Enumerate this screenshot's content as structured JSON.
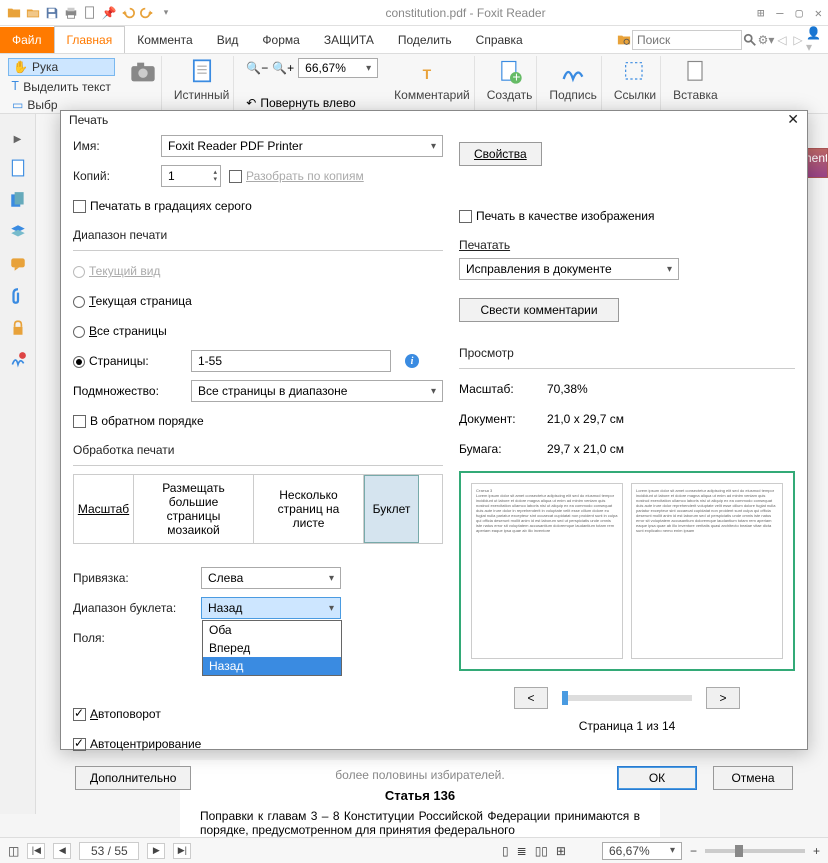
{
  "titlebar": {
    "title": "constitution.pdf - Foxit Reader"
  },
  "tabs": {
    "file": "Файл",
    "items": [
      "Главная",
      "Коммента",
      "Вид",
      "Форма",
      "ЗАЩИТА",
      "Поделить",
      "Справка"
    ],
    "active_index": 0,
    "search_placeholder": "Поиск"
  },
  "ribbon": {
    "hand": "Рука",
    "select_text": "Выделить текст",
    "selection": "Выбр",
    "true_size": "Истинный",
    "zoom_value": "66,67%",
    "rotate_left": "Повернуть влево",
    "comment": "Комментарий",
    "create": "Создать",
    "sign": "Подпись",
    "links": "Ссылки",
    "insert": "Вставка"
  },
  "dialog": {
    "title": "Печать",
    "name_label": "Имя:",
    "printer": "Foxit Reader PDF Printer",
    "properties": "Свойства",
    "copies_label": "Копий:",
    "copies": "1",
    "collate": "Разобрать по копиям",
    "grayscale": "Печатать в градациях серого",
    "as_image": "Печать в качестве изображения",
    "range_title": "Диапазон печати",
    "range": {
      "current_view": "Текущий вид",
      "current_page": "Текущая страница",
      "all_pages": "Все страницы",
      "pages": "Страницы:",
      "pages_value": "1-55",
      "selected": "pages"
    },
    "subset_label": "Подмножество:",
    "subset": "Все страницы в диапазоне",
    "reverse": "В обратном порядке",
    "handling_title": "Обработка печати",
    "handling": {
      "scale": "Масштаб",
      "tile": "Размещать большие страницы мозаикой",
      "multi": "Несколько страниц на листе",
      "booklet": "Буклет",
      "active": "booklet"
    },
    "binding_label": "Привязка:",
    "binding": "Слева",
    "booklet_range_label": "Диапазон буклета:",
    "booklet_range_value": "Назад",
    "booklet_options": [
      "Оба",
      "Вперед",
      "Назад"
    ],
    "booklet_selected_index": 2,
    "fields_label": "Поля:",
    "autorotate": "Автоповорот",
    "autocenter": "Автоцентрирование",
    "advanced": "Дополнительно",
    "print_what_title": "Печатать",
    "print_what": "Исправления в документе",
    "flatten": "Свести комментарии",
    "preview_title": "Просмотр",
    "scale_label": "Масштаб:",
    "scale_value": "70,38%",
    "doc_label": "Документ:",
    "doc_value": "21,0 x 29,7 см",
    "paper_label": "Бумага:",
    "paper_value": "29,7 x 21,0 см",
    "page_of": "Страница 1 из 14",
    "ok": "ОК",
    "cancel": "Отмена"
  },
  "doc_behind": {
    "faded": "более половины избирателей.",
    "article": "Статья 136",
    "para": "Поправки к главам 3 – 8 Конституции Российской Федерации принимаются в порядке, предусмотренном для принятия федерального"
  },
  "statusbar": {
    "page": "53 / 55",
    "zoom": "66,67%"
  },
  "side_tab": "uments ds"
}
